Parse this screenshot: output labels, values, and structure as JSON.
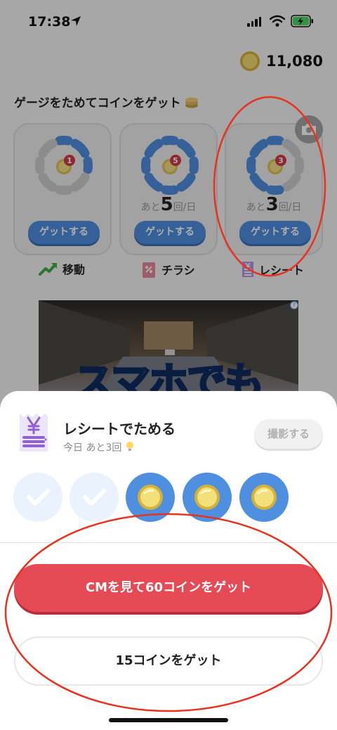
{
  "status": {
    "time": "17:38"
  },
  "balance": {
    "value": "11,080"
  },
  "section": {
    "title": "ゲージをためてコインをゲット"
  },
  "cards": [
    {
      "badge": "1",
      "remain_prefix": "",
      "remain_num": "",
      "remain_suffix": "",
      "button": "ゲットする",
      "label": "移動"
    },
    {
      "badge": "5",
      "remain_prefix": "あと",
      "remain_num": "5",
      "remain_suffix": "回/日",
      "button": "ゲットする",
      "label": "チラシ"
    },
    {
      "badge": "3",
      "remain_prefix": "あと",
      "remain_num": "3",
      "remain_suffix": "回/日",
      "button": "ゲットする",
      "label": "レシート"
    }
  ],
  "ad": {
    "text": "スマホでも"
  },
  "sheet": {
    "title": "レシートでためる",
    "subtitle": "今日 あと3回",
    "shoot_button": "撮影する",
    "cm_button": "CMを見て60コインをゲット",
    "coin_button": "15コインをゲット"
  },
  "colors": {
    "accent_blue": "#4f8fe0",
    "cm_red": "#e54a55",
    "annotation_red": "#e8321f"
  }
}
